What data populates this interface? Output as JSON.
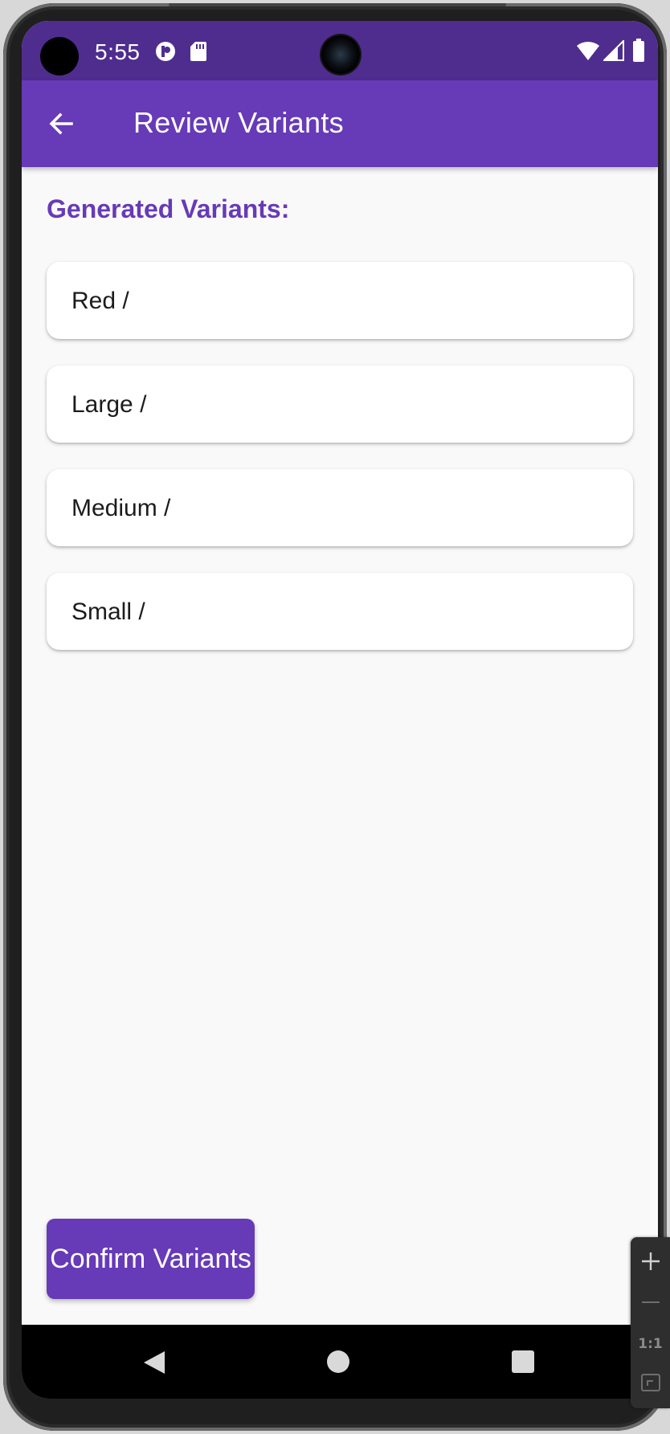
{
  "status_bar": {
    "time": "5:55",
    "icons": [
      "camera-cutout-icon",
      "screen-record-icon",
      "sd-card-icon",
      "wifi-icon",
      "cell-signal-icon",
      "battery-icon"
    ]
  },
  "app_bar": {
    "title": "Review Variants",
    "back_icon": "arrow-left-icon"
  },
  "main": {
    "heading": "Generated Variants:",
    "variants": [
      {
        "label": "Red /"
      },
      {
        "label": "Large /"
      },
      {
        "label": "Medium /"
      },
      {
        "label": "Small /"
      }
    ],
    "confirm_label": "Confirm Variants"
  },
  "nav_bar": {
    "icons": [
      "nav-back-icon",
      "nav-home-icon",
      "nav-recents-icon"
    ]
  },
  "emulator_toolbar": {
    "zoom_in_icon": "plus-icon",
    "zoom_out_icon": "minus-icon",
    "actual_size_label": "1:1",
    "fit_icon": "fit-screen-icon"
  },
  "colors": {
    "primary": "#673ab7",
    "status_bar": "#4f2d8f",
    "background": "#f9f9f9",
    "card": "#ffffff",
    "nav_bar": "#000000"
  }
}
